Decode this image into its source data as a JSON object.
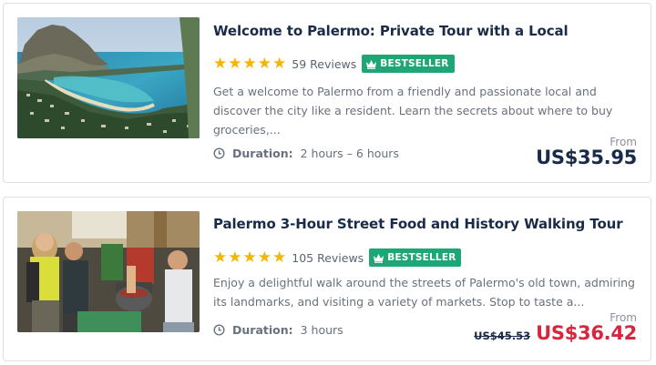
{
  "tours": [
    {
      "title": "Welcome to Palermo: Private Tour with a Local",
      "rating": 5,
      "reviews": "59 Reviews",
      "badge": "BESTSELLER",
      "description": "Get a welcome to Palermo from a friendly and passionate local and discover the city like a resident. Learn the secrets about where to buy groceries,...",
      "duration_label": "Duration:",
      "duration_value": "2 hours – 6 hours",
      "price_from_label": "From",
      "price": "US$35.95",
      "old_price": ""
    },
    {
      "title": "Palermo 3-Hour Street Food and History Walking Tour",
      "rating": 5,
      "reviews": "105 Reviews",
      "badge": "BESTSELLER",
      "description": "Enjoy a delightful walk around the streets of Palermo's old town, admiring its landmarks, and visiting a variety of markets. Stop to taste a...",
      "duration_label": "Duration:",
      "duration_value": "3 hours",
      "price_from_label": "From",
      "price": "US$36.42",
      "old_price": "US$45.53"
    }
  ],
  "colors": {
    "title": "#1a2b49",
    "star": "#f7b500",
    "badge": "#1fa676",
    "sale_price": "#d7263d",
    "muted_text": "#68717d"
  },
  "icons": {
    "star": "star-icon",
    "badge": "crown-icon",
    "duration": "clock-icon"
  }
}
